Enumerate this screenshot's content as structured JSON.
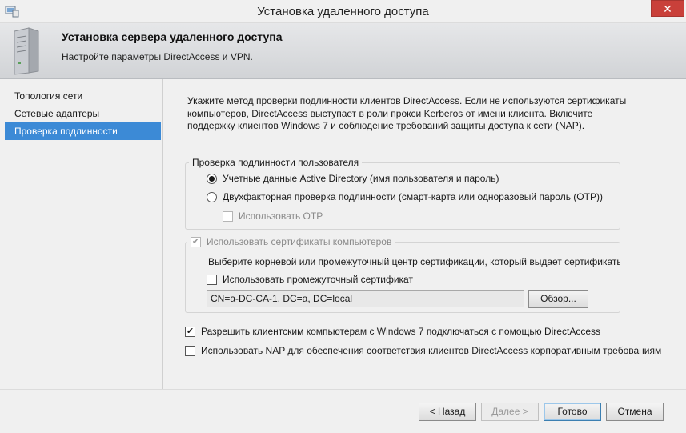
{
  "window": {
    "title": "Установка удаленного доступа",
    "close_glyph": "✕"
  },
  "header": {
    "title": "Установка сервера удаленного доступа",
    "subtitle": "Настройте параметры DirectAccess и VPN."
  },
  "sidebar": {
    "items": [
      {
        "label": "Топология сети"
      },
      {
        "label": "Сетевые адаптеры"
      },
      {
        "label": "Проверка подлинности"
      }
    ]
  },
  "content": {
    "intro_lines": [
      "Укажите метод проверки подлинности клиентов DirectAccess. Если не используются сертификаты",
      "компьютеров, DirectAccess выступает в роли прокси Kerberos от имени клиента. Включите",
      "поддержку клиентов Windows 7 и соблюдение требований защиты доступа к сети (NAP)."
    ],
    "auth_group": {
      "legend": "Проверка подлинности пользователя",
      "option_ad": "Учетные данные Active Directory (имя пользователя и пароль)",
      "option_two_factor": "Двухфакторная проверка подлинности (смарт-карта или одноразовый пароль (OTP))",
      "use_otp": "Использовать OTP"
    },
    "cert_group": {
      "legend": "Использовать сертификаты компьютеров",
      "description": "Выберите корневой или промежуточный центр сертификации, который выдает сертификаты",
      "use_intermediate": "Использовать промежуточный сертификат",
      "cert_value": "CN=a-DC-CA-1, DC=a, DC=local",
      "browse_label": "Обзор..."
    },
    "allow_win7": "Разрешить клиентским компьютерам с Windows 7 подключаться с помощью DirectAccess",
    "use_nap": "Использовать NAP для обеспечения соответствия клиентов DirectAccess корпоративным требованиям"
  },
  "footer": {
    "back_label": "< Назад",
    "next_label": "Далее >",
    "finish_label": "Готово",
    "cancel_label": "Отмена"
  },
  "icons": {
    "app": "remote-access-setup-icon",
    "server": "server-tower-icon",
    "check": "✔"
  },
  "colors": {
    "selection": "#3c8ad6",
    "close": "#c9403a"
  }
}
